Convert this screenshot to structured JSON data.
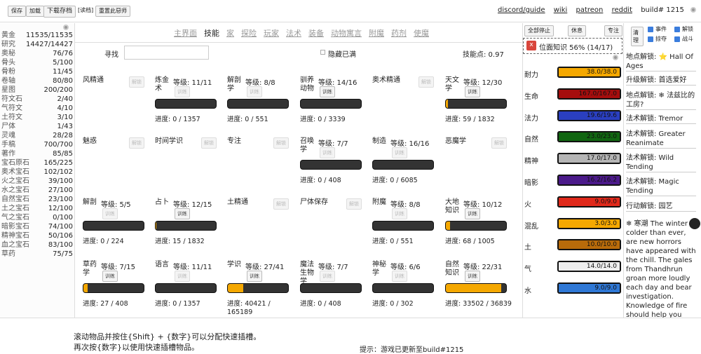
{
  "toolbar": {
    "save": "保存",
    "load": "加载",
    "download": "下载存档",
    "read": "[读档]",
    "reset": "重置此惡师"
  },
  "links": {
    "discord": "discord/guide",
    "wiki": "wiki",
    "patreon": "patreon",
    "reddit": "reddit",
    "build": "build# 1215"
  },
  "resources": [
    {
      "name": "黄金",
      "value": "11535/11535"
    },
    {
      "name": "研究",
      "value": "14427/14427"
    },
    {
      "name": "奥秘",
      "value": "76/76"
    },
    {
      "name": "骨头",
      "value": "5/100"
    },
    {
      "name": "骨粉",
      "value": "11/45"
    },
    {
      "name": "卷轴",
      "value": "80/80"
    },
    {
      "name": "星图",
      "value": "200/200"
    },
    {
      "name": "符文石",
      "value": "2/40"
    },
    {
      "name": "气符文",
      "value": "4/10"
    },
    {
      "name": "土符文",
      "value": "3/10"
    },
    {
      "name": "尸体",
      "value": "1/43"
    },
    {
      "name": "灵魂",
      "value": "28/28"
    },
    {
      "name": "手稿",
      "value": "700/700"
    },
    {
      "name": "著作",
      "value": "85/85"
    },
    {
      "name": "宝石原石",
      "value": "165/225"
    },
    {
      "name": "奥术宝石",
      "value": "102/102"
    },
    {
      "name": "火之宝石",
      "value": "39/100"
    },
    {
      "name": "水之宝石",
      "value": "27/100"
    },
    {
      "name": "自然宝石",
      "value": "23/100"
    },
    {
      "name": "土之宝石",
      "value": "12/100"
    },
    {
      "name": "气之宝石",
      "value": "0/100"
    },
    {
      "name": "暗影宝石",
      "value": "74/100"
    },
    {
      "name": "精神宝石",
      "value": "50/106"
    },
    {
      "name": "血之宝石",
      "value": "83/100"
    },
    {
      "name": "草药",
      "value": "75/75"
    }
  ],
  "tabs": [
    "主界面",
    "技能",
    "家",
    "探险",
    "玩家",
    "法术",
    "装备",
    "动物寓言",
    "附魔",
    "药剂",
    "使魔"
  ],
  "skills_header": {
    "find_label": "寻找",
    "hide_full": "隐藏已满",
    "points": "技能点: 0.97"
  },
  "skills": [
    {
      "name": "风精通",
      "level": "",
      "action": "解锁",
      "active": false,
      "fill": 0,
      "progress": ""
    },
    {
      "name": "炼金术",
      "level": "等级: 11/11",
      "action": "训练",
      "active": false,
      "fill": 0,
      "progress": "进度: 0 / 1357"
    },
    {
      "name": "解剖学",
      "level": "等级: 8/8",
      "action": "训练",
      "active": false,
      "fill": 0,
      "progress": "进度: 0 / 551"
    },
    {
      "name": "驯养动物",
      "level": "等级: 14/16",
      "action": "训练",
      "active": true,
      "fill": 0,
      "progress": "进度: 0 / 3339"
    },
    {
      "name": "奥术精通",
      "level": "",
      "action": "解锁",
      "active": false,
      "fill": 0,
      "progress": ""
    },
    {
      "name": "天文学",
      "level": "等级: 12/30",
      "action": "训练",
      "active": true,
      "fill": 0.032,
      "progress": "进度: 59 / 1832"
    },
    {
      "name": "魅惑",
      "level": "",
      "action": "解锁",
      "active": false,
      "fill": 0,
      "progress": ""
    },
    {
      "name": "时间学识",
      "level": "",
      "action": "解锁",
      "active": false,
      "fill": 0,
      "progress": ""
    },
    {
      "name": "专注",
      "level": "",
      "action": "解锁",
      "active": false,
      "fill": 0,
      "progress": ""
    },
    {
      "name": "召唤学",
      "level": "等级: 7/7",
      "action": "训练",
      "active": false,
      "fill": 0,
      "progress": "进度: 0 / 408"
    },
    {
      "name": "制造",
      "level": "等级: 16/16",
      "action": "训练",
      "active": false,
      "fill": 0,
      "progress": "进度: 0 / 6085"
    },
    {
      "name": "恶魔学",
      "level": "",
      "action": "解锁",
      "active": false,
      "fill": 0,
      "progress": ""
    },
    {
      "name": "解剖",
      "level": "等级: 5/5",
      "action": "训练",
      "active": false,
      "fill": 0,
      "progress": "进度: 0 / 224"
    },
    {
      "name": "占卜",
      "level": "等级: 12/15",
      "action": "训练",
      "active": true,
      "fill": 0.008,
      "progress": "进度: 15 / 1832"
    },
    {
      "name": "土精通",
      "level": "",
      "action": "解锁",
      "active": false,
      "fill": 0,
      "progress": ""
    },
    {
      "name": "尸体保存",
      "level": "",
      "action": "解锁",
      "active": false,
      "fill": 0,
      "progress": ""
    },
    {
      "name": "附魔",
      "level": "等级: 8/8",
      "action": "训练",
      "active": false,
      "fill": 0,
      "progress": "进度: 0 / 551"
    },
    {
      "name": "大地知识",
      "level": "等级: 10/12",
      "action": "训练",
      "active": true,
      "fill": 0.068,
      "progress": "进度: 68 / 1005"
    },
    {
      "name": "草药学",
      "level": "等级: 7/15",
      "action": "训练",
      "active": true,
      "fill": 0.066,
      "progress": "进度: 27 / 408"
    },
    {
      "name": "语言",
      "level": "等级: 11/11",
      "action": "训练",
      "active": false,
      "fill": 0,
      "progress": "进度: 0 / 1357"
    },
    {
      "name": "学识",
      "level": "等级: 27/41",
      "action": "训练",
      "active": true,
      "fill": 0.25,
      "progress": "进度: 40421 / 165189"
    },
    {
      "name": "魔法生物学",
      "level": "等级: 7/7",
      "action": "训练",
      "active": false,
      "fill": 0,
      "progress": "进度: 0 / 408"
    },
    {
      "name": "神秘学",
      "level": "等级: 6/6",
      "action": "训练",
      "active": false,
      "fill": 0,
      "progress": "进度: 0 / 302"
    },
    {
      "name": "自然知识",
      "level": "等级: 22/31",
      "action": "训练",
      "active": true,
      "fill": 0.92,
      "progress": "进度: 33502 / 36839"
    }
  ],
  "stats_header": {
    "stop_all": "全部停止",
    "rest": "休息",
    "focus": "专注",
    "close": "x",
    "task": "位面知识 56% (14/17)"
  },
  "stats": [
    {
      "name": "耐力",
      "value": "38.0/38.0",
      "color": "#f5a800",
      "fill": 1
    },
    {
      "name": "生命",
      "value": "167.0/167.0",
      "color": "#a50d0d",
      "fill": 1
    },
    {
      "name": "法力",
      "value": "19.6/19.6",
      "color": "#2a3fc0",
      "fill": 1
    },
    {
      "name": "自然",
      "value": "23.0/23.0",
      "color": "#116611",
      "fill": 1
    },
    {
      "name": "精神",
      "value": "17.0/17.0",
      "color": "#b5b5b5",
      "fill": 1
    },
    {
      "name": "暗影",
      "value": "16.2/16.2",
      "color": "#4b1a8a",
      "fill": 1
    },
    {
      "name": "火",
      "value": "9.0/9.0",
      "color": "#e0291b",
      "fill": 1
    },
    {
      "name": "混乱",
      "value": "3.0/3.0",
      "color": "#f5a800",
      "fill": 1
    },
    {
      "name": "土",
      "value": "10.0/10.0",
      "color": "#b86b0a",
      "fill": 1
    },
    {
      "name": "气",
      "value": "14.0/14.0",
      "color": "#eeeeee",
      "fill": 1
    },
    {
      "name": "水",
      "value": "9.0/9.0",
      "color": "#2f78d6",
      "fill": 1
    }
  ],
  "log_header": {
    "clear": "清理",
    "events": "事件",
    "unlocks": "解锁",
    "loot": "掠夺",
    "combat": "战斗"
  },
  "log": [
    {
      "text": "地点解锁: ⭐ Hall Of Ages"
    },
    {
      "text": "升级解锁: 首选爱好"
    },
    {
      "text": "地点解锁: ❄ 法兹比的工房?"
    },
    {
      "text": "法术解锁: Tremor"
    },
    {
      "text": "法术解锁: Greater Reanimate"
    },
    {
      "text": "法术解锁: Wild Tending"
    },
    {
      "text": "法术解锁: Magic Tending"
    },
    {
      "text": "行动解锁: 园艺"
    },
    {
      "text": "❄ 寒潮 The winter is colder than ever, are new horrors have appeared with the chill. The gales from Thandhrun groan more loudly each day and bear investigation. Knowledge of fire should help you"
    }
  ],
  "footer": {
    "line1": "滚动物品并按住{Shift} + {数字}可以分配快速插槽。",
    "line2": "再次按{数字}以使用快速插槽物品。",
    "tip": "提示：游戏已更新至build#1215"
  }
}
